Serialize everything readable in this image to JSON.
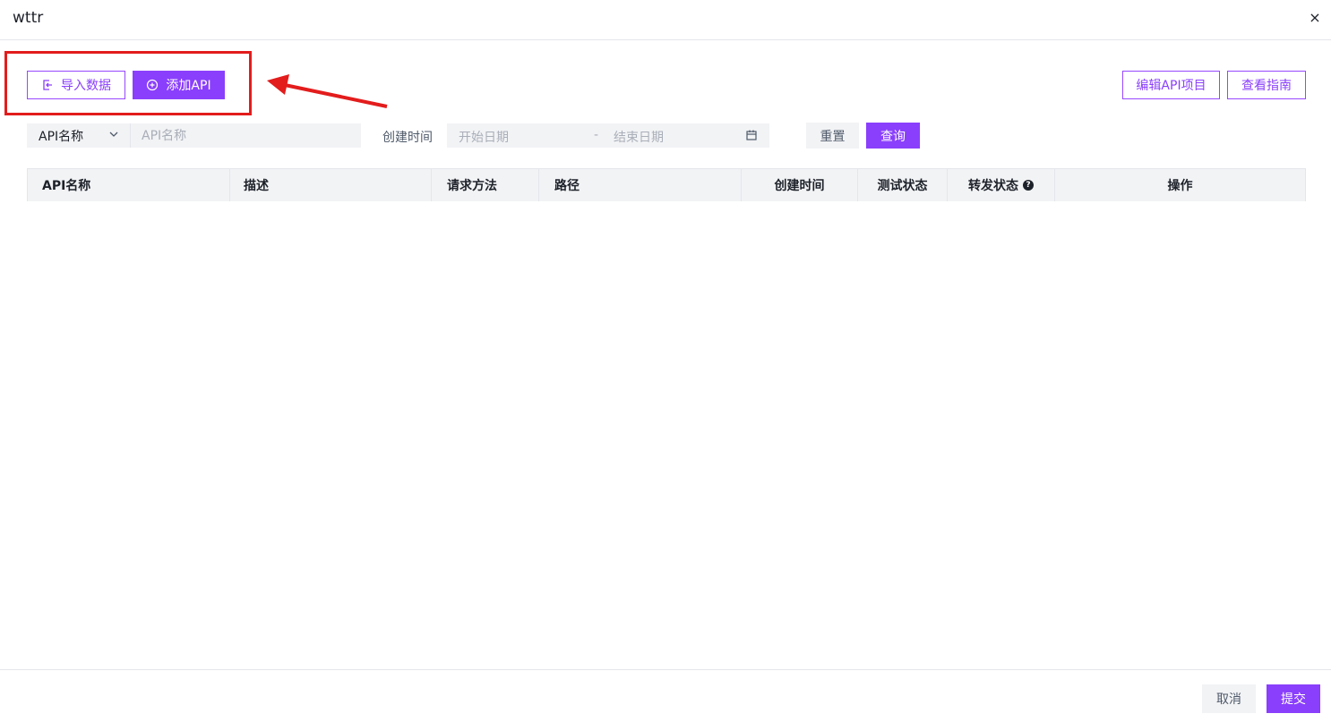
{
  "window": {
    "title": "wttr",
    "close_glyph": "×"
  },
  "toolbar": {
    "import_label": "导入数据",
    "add_api_label": "添加API",
    "edit_project_label": "编辑API项目",
    "guide_label": "查看指南"
  },
  "filter": {
    "field_select": "API名称",
    "search_placeholder": "API名称",
    "date_label": "创建时间",
    "start_placeholder": "开始日期",
    "separator": "-",
    "end_placeholder": "结束日期",
    "reset_label": "重置",
    "query_label": "查询"
  },
  "table": {
    "columns": [
      {
        "label": "API名称"
      },
      {
        "label": "描述"
      },
      {
        "label": "请求方法"
      },
      {
        "label": "路径"
      },
      {
        "label": "创建时间"
      },
      {
        "label": "测试状态"
      },
      {
        "label": "转发状态"
      },
      {
        "label": "操作"
      }
    ],
    "help_glyph": "?"
  },
  "footer": {
    "cancel_label": "取消",
    "submit_label": "提交"
  },
  "colors": {
    "accent": "#8a3ffc",
    "annotation": "#e31c1c"
  }
}
